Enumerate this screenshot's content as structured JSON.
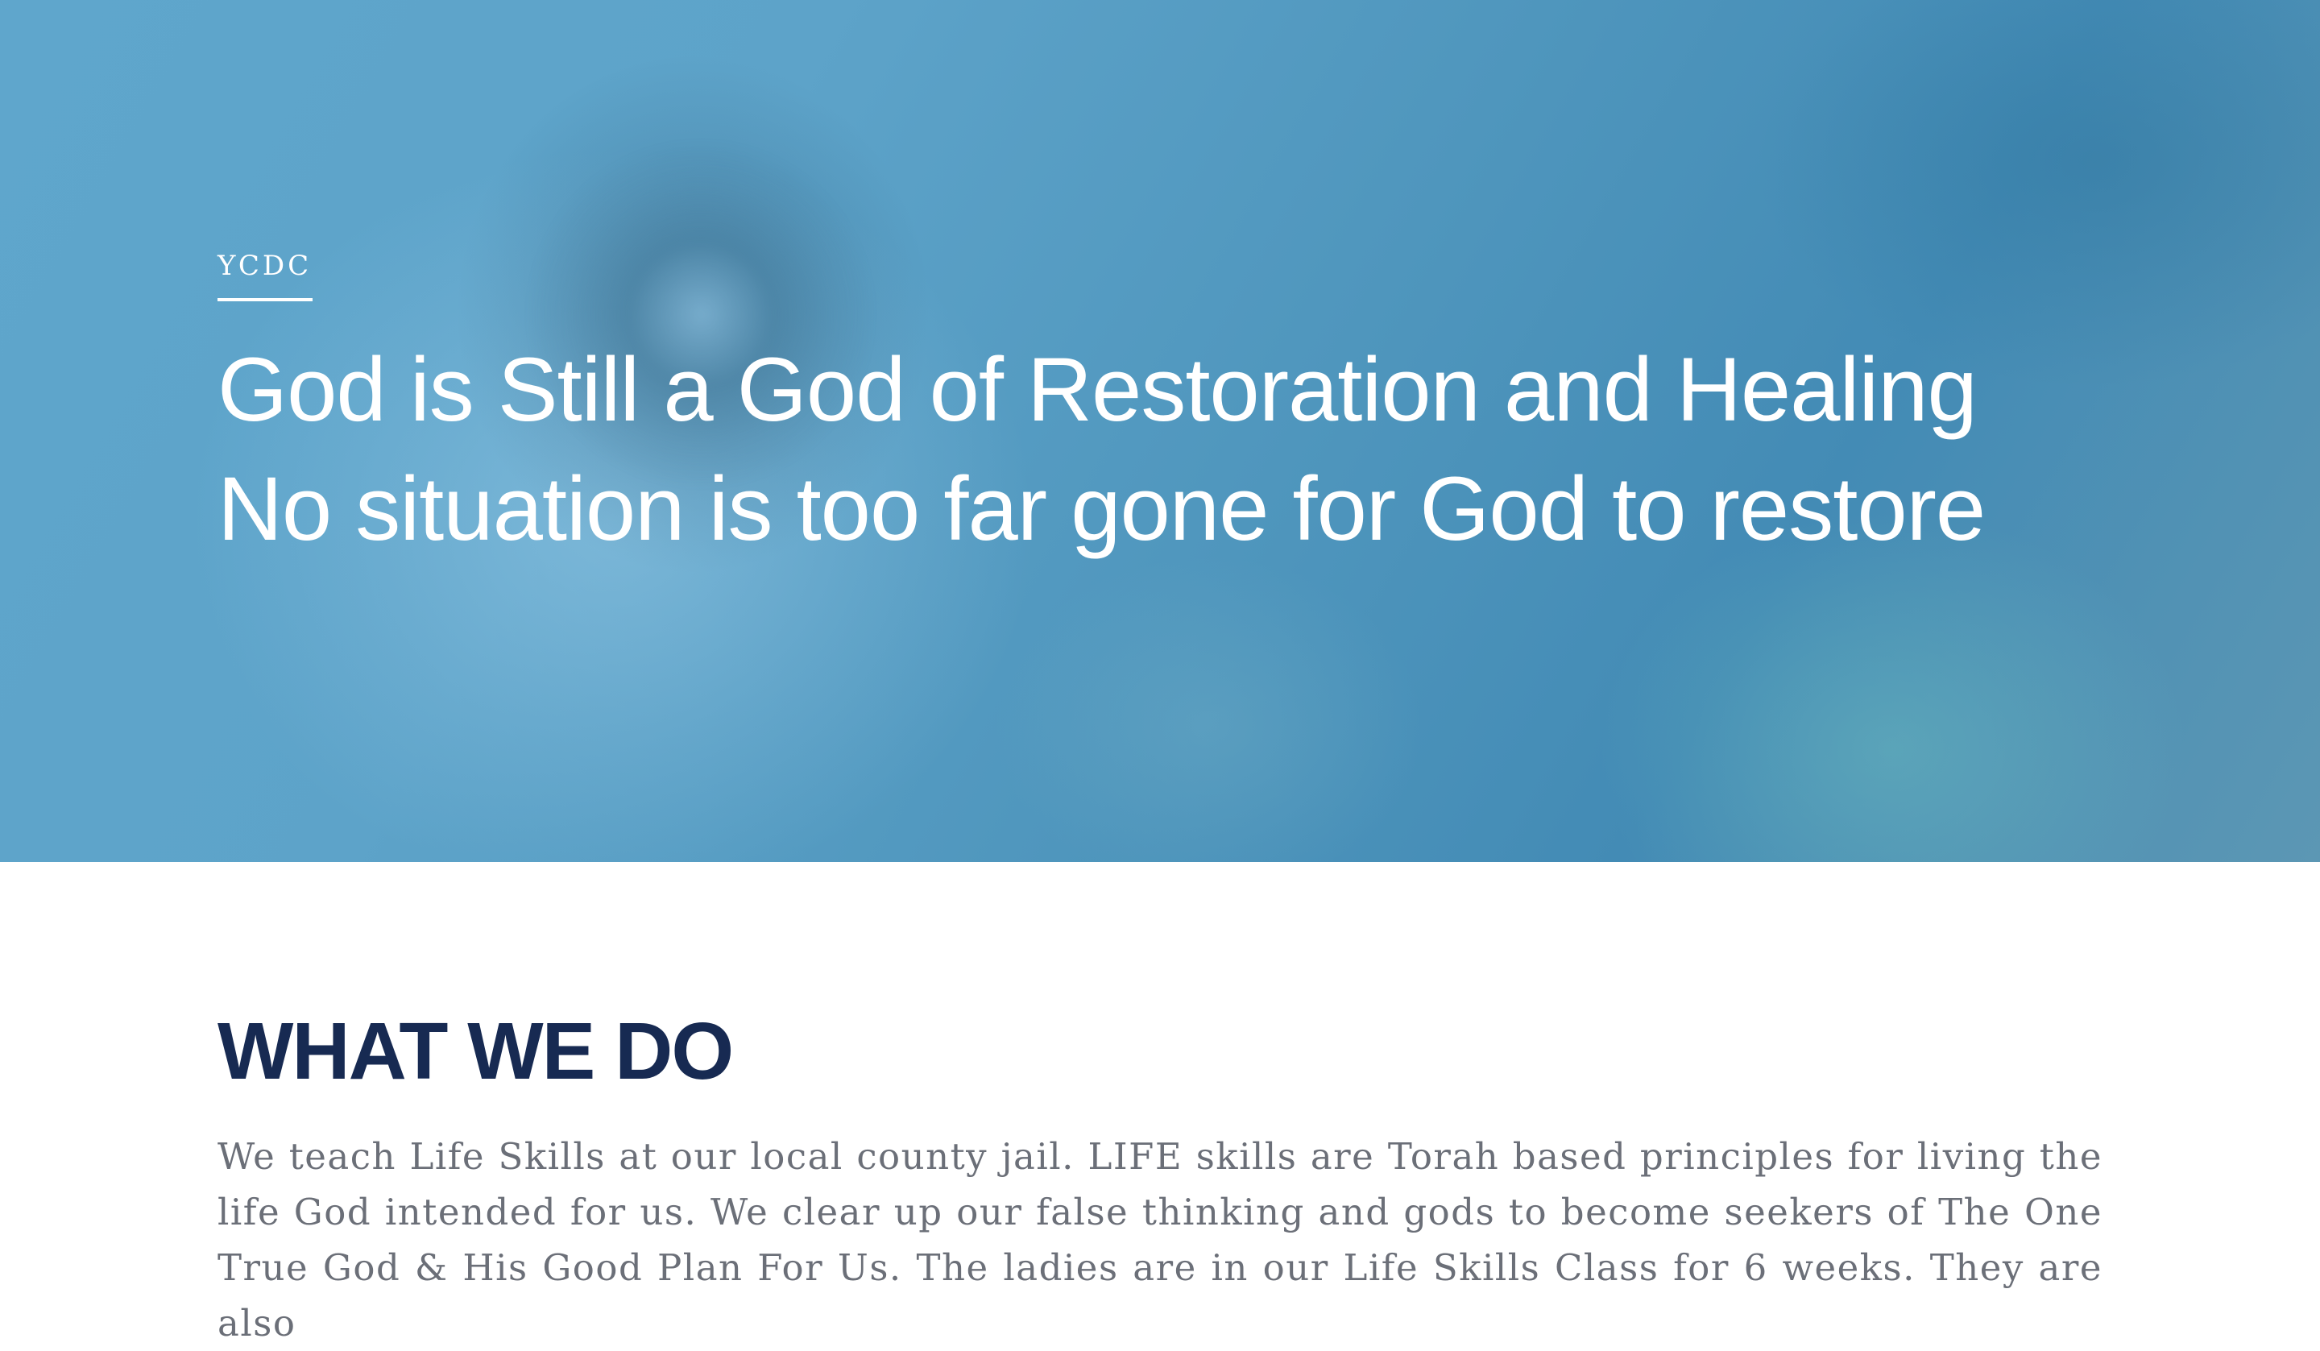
{
  "hero": {
    "eyebrow": "YCDC",
    "title_line_1": "God is Still a God of Restoration and Healing",
    "title_line_2": "No situation is too far gone for God to restore"
  },
  "what_we_do": {
    "heading": "WHAT WE DO",
    "body": "We teach Life Skills at our local county jail. LIFE skills are Torah based principles for living the life God intended for us. We clear up our false thinking and gods to become seekers of The One True God & His Good Plan For Us. The ladies are in our Life Skills Class for 6 weeks. They are also"
  },
  "colors": {
    "hero_blue": "#5da3c9",
    "heading_navy": "#172a52",
    "body_gray": "#6b6f78"
  }
}
